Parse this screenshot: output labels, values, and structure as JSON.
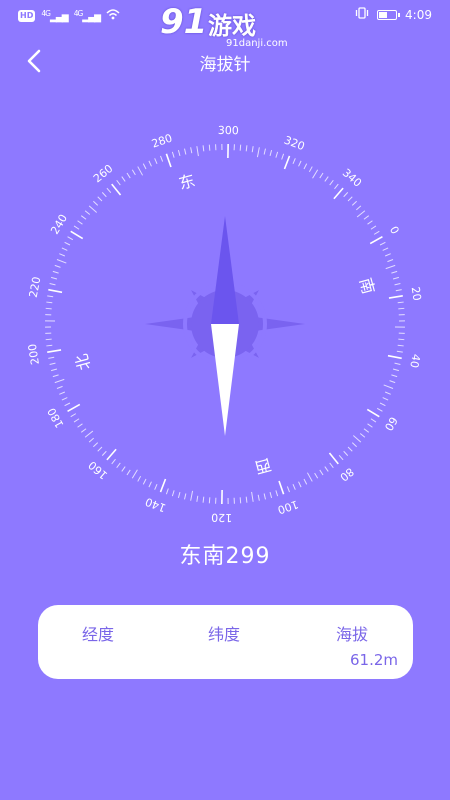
{
  "status_bar": {
    "chip": "HD",
    "signal_1": "4G",
    "signal_2": "4G",
    "time": "4:09",
    "battery_level": 0.55
  },
  "watermark": {
    "logo": "91",
    "name": "游戏",
    "url": "91danji.com"
  },
  "header": {
    "title": "海拔针",
    "back_icon": "chevron-left-icon"
  },
  "compass": {
    "tick_labels": [
      "0",
      "20",
      "40",
      "60",
      "80",
      "100",
      "120",
      "140",
      "160",
      "180",
      "200",
      "220",
      "240",
      "260",
      "280",
      "300",
      "320",
      "340"
    ],
    "directions": [
      {
        "label": "南",
        "bearing": 14
      },
      {
        "label": "西",
        "bearing": 104
      },
      {
        "label": "北",
        "bearing": 194
      },
      {
        "label": "东",
        "bearing": 284
      }
    ],
    "rotation_deg": 299,
    "colors": {
      "needle_north": "#6b55ee",
      "needle_south": "#ffffff",
      "rose": "#7a63f0",
      "dial": "#ffffff"
    }
  },
  "readout": {
    "heading_text": "东南299"
  },
  "info": {
    "longitude_label": "经度",
    "longitude_value": "",
    "latitude_label": "纬度",
    "latitude_value": "",
    "altitude_label": "海拔",
    "altitude_value": "61.2m"
  }
}
